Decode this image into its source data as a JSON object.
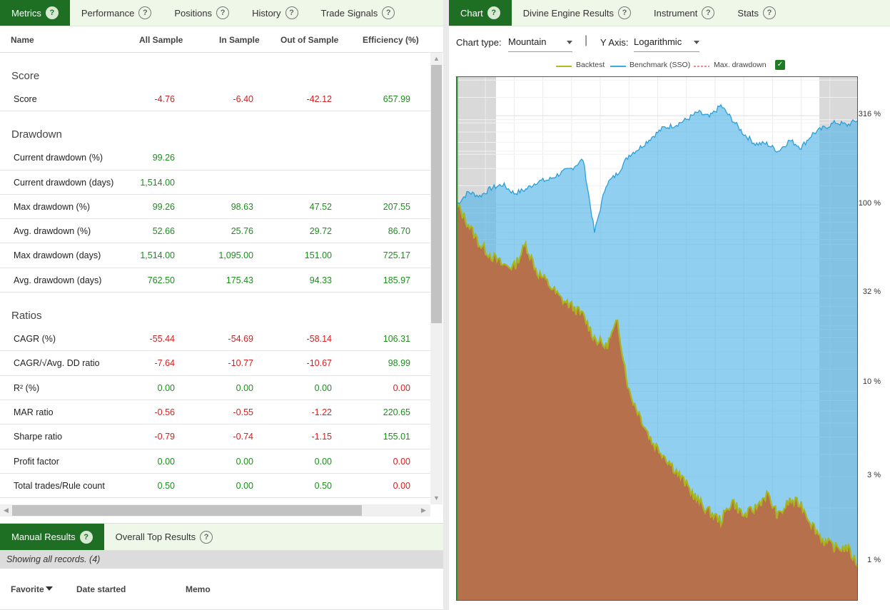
{
  "left_tabs": [
    {
      "label": "Metrics"
    },
    {
      "label": "Performance"
    },
    {
      "label": "Positions"
    },
    {
      "label": "History"
    },
    {
      "label": "Trade Signals"
    }
  ],
  "metrics_columns": [
    "Name",
    "All Sample",
    "In Sample",
    "Out of Sample",
    "Efficiency (%)"
  ],
  "sections": [
    {
      "title": "Score",
      "rows": [
        {
          "name": "Score",
          "values": [
            "-4.76",
            "-6.40",
            "-42.12",
            "657.99"
          ],
          "colors": [
            "r",
            "r",
            "r",
            "g"
          ]
        }
      ]
    },
    {
      "title": "Drawdown",
      "rows": [
        {
          "name": "Current drawdown (%)",
          "values": [
            "99.26",
            "",
            "",
            ""
          ],
          "colors": [
            "g",
            "g",
            "g",
            "g"
          ]
        },
        {
          "name": "Current drawdown (days)",
          "values": [
            "1,514.00",
            "",
            "",
            ""
          ],
          "colors": [
            "g",
            "g",
            "g",
            "g"
          ]
        },
        {
          "name": "Max drawdown (%)",
          "values": [
            "99.26",
            "98.63",
            "47.52",
            "207.55"
          ],
          "colors": [
            "g",
            "g",
            "g",
            "g"
          ]
        },
        {
          "name": "Avg. drawdown (%)",
          "values": [
            "52.66",
            "25.76",
            "29.72",
            "86.70"
          ],
          "colors": [
            "g",
            "g",
            "g",
            "g"
          ]
        },
        {
          "name": "Max drawdown (days)",
          "values": [
            "1,514.00",
            "1,095.00",
            "151.00",
            "725.17"
          ],
          "colors": [
            "g",
            "g",
            "g",
            "g"
          ]
        },
        {
          "name": "Avg. drawdown (days)",
          "values": [
            "762.50",
            "175.43",
            "94.33",
            "185.97"
          ],
          "colors": [
            "g",
            "g",
            "g",
            "g"
          ]
        }
      ]
    },
    {
      "title": "Ratios",
      "rows": [
        {
          "name": "CAGR (%)",
          "values": [
            "-55.44",
            "-54.69",
            "-58.14",
            "106.31"
          ],
          "colors": [
            "r",
            "r",
            "r",
            "g"
          ]
        },
        {
          "name": "CAGR/√Avg. DD ratio",
          "values": [
            "-7.64",
            "-10.77",
            "-10.67",
            "98.99"
          ],
          "colors": [
            "r",
            "r",
            "r",
            "g"
          ]
        },
        {
          "name": "R² (%)",
          "values": [
            "0.00",
            "0.00",
            "0.00",
            "0.00"
          ],
          "colors": [
            "g",
            "g",
            "g",
            "r"
          ]
        },
        {
          "name": "MAR ratio",
          "values": [
            "-0.56",
            "-0.55",
            "-1.22",
            "220.65"
          ],
          "colors": [
            "r",
            "r",
            "r",
            "g"
          ]
        },
        {
          "name": "Sharpe ratio",
          "values": [
            "-0.79",
            "-0.74",
            "-1.15",
            "155.01"
          ],
          "colors": [
            "r",
            "r",
            "r",
            "g"
          ]
        },
        {
          "name": "Profit factor",
          "values": [
            "0.00",
            "0.00",
            "0.00",
            "0.00"
          ],
          "colors": [
            "g",
            "g",
            "g",
            "r"
          ]
        },
        {
          "name": "Total trades/Rule count",
          "values": [
            "0.50",
            "0.00",
            "0.50",
            "0.00"
          ],
          "colors": [
            "g",
            "g",
            "g",
            "r"
          ]
        }
      ]
    }
  ],
  "bottom_tabs": [
    {
      "label": "Manual Results"
    },
    {
      "label": "Overall Top Results"
    }
  ],
  "showing_text": "Showing all records. (4)",
  "results_columns": [
    "Favorite",
    "Date started",
    "Memo"
  ],
  "right_tabs": [
    {
      "label": "Chart"
    },
    {
      "label": "Divine Engine Results"
    },
    {
      "label": "Instrument"
    },
    {
      "label": "Stats"
    }
  ],
  "chart_controls": {
    "chart_type_label": "Chart type:",
    "chart_type_value": "Mountain",
    "y_axis_label": "Y Axis:",
    "y_axis_value": "Logarithmic"
  },
  "colors": {
    "accent": "#1e6e23",
    "positive": "#1c8e1c",
    "negative": "#d42020",
    "backtest": "#b5b81e",
    "benchmark": "#3aaee0",
    "drawdown": "#e89090"
  },
  "chart_data": {
    "type": "area",
    "title": "",
    "y_scale": "log",
    "y_ticks": [
      "316 %",
      "100 %",
      "32 %",
      "10 %",
      "3 %",
      "1 %"
    ],
    "y_tick_values": [
      316,
      100,
      32,
      10,
      3,
      1
    ],
    "ylim": [
      0.6,
      520
    ],
    "legend": [
      "Backtest",
      "Benchmark (SSO)",
      "Max. drawdown"
    ],
    "legend_placement": "top",
    "grid": true,
    "series": [
      {
        "name": "Backtest",
        "values": [
          100,
          78,
          60,
          52,
          46,
          45,
          60,
          42,
          36,
          30,
          27,
          24,
          18,
          16,
          22,
          9,
          6.5,
          4.7,
          4.0,
          3.3,
          2.7,
          2.2,
          1.9,
          1.7,
          2.2,
          1.8,
          2.0,
          2.4,
          1.8,
          2.2,
          2.1,
          1.6,
          1.3,
          1.2,
          1.2,
          0.95
        ]
      },
      {
        "name": "Benchmark (SSO)",
        "values": [
          100,
          118,
          112,
          124,
          130,
          116,
          122,
          135,
          138,
          150,
          160,
          180,
          70,
          130,
          150,
          190,
          210,
          240,
          270,
          280,
          300,
          330,
          310,
          360,
          300,
          250,
          220,
          220,
          200,
          230,
          210,
          250,
          270,
          290,
          280,
          300
        ]
      }
    ]
  }
}
